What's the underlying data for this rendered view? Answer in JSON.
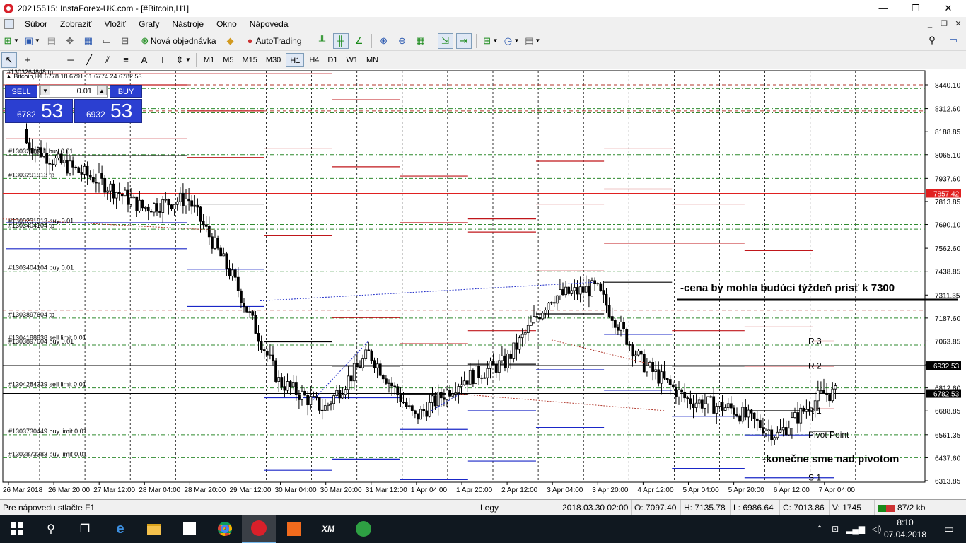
{
  "window": {
    "title": "20215515: InstaForex-UK.com - [#Bitcoin,H1]",
    "controls": {
      "minimize": "—",
      "maximize": "❐",
      "close": "✕"
    }
  },
  "menu": {
    "items": [
      "Súbor",
      "Zobraziť",
      "Vložiť",
      "Grafy",
      "Nástroje",
      "Okno",
      "Nápoveda"
    ],
    "mdi_controls": {
      "minimize": "_",
      "restore": "❐",
      "close": "✕"
    }
  },
  "toolbar": {
    "new_order_label": "Nová objednávka",
    "autotrading_label": "AutoTrading"
  },
  "timeframes": {
    "items": [
      "M1",
      "M5",
      "M15",
      "M30",
      "H1",
      "H4",
      "D1",
      "W1",
      "MN"
    ],
    "active": "H1"
  },
  "chart": {
    "symbol_line": "▲ Bitcoin,H1  6778.18 6791.61 6774.24 6782.53",
    "header_partial": "#1303264848 tp",
    "one_click": {
      "sell_label": "SELL",
      "buy_label": "BUY",
      "lot": "0.01",
      "sell_price_small": "6782",
      "sell_price_big": "53",
      "buy_price_small": "6932",
      "buy_price_big": "53"
    },
    "price_axis": [
      "8440.10",
      "8312.60",
      "8188.85",
      "8065.10",
      "7937.60",
      "7813.85",
      "7690.10",
      "7562.60",
      "7438.85",
      "7311.35",
      "7187.60",
      "7063.85",
      "6936.35",
      "6812.60",
      "6688.85",
      "6561.35",
      "6437.60",
      "6313.85"
    ],
    "price_markers": [
      {
        "label": "7857.42",
        "color": "#e02020",
        "value": 7857.42
      },
      {
        "label": "6932.53",
        "color": "#000000",
        "value": 6932.53
      },
      {
        "label": "6782.53",
        "color": "#000000",
        "value": 6782.53
      }
    ],
    "time_axis": [
      "26 Mar 2018",
      "26 Mar 20:00",
      "27 Mar 12:00",
      "28 Mar 04:00",
      "28 Mar 20:00",
      "29 Mar 12:00",
      "30 Mar 04:00",
      "30 Mar 20:00",
      "31 Mar 12:00",
      "1 Apr 04:00",
      "1 Apr 20:00",
      "2 Apr 12:00",
      "3 Apr 04:00",
      "3 Apr 20:00",
      "4 Apr 12:00",
      "5 Apr 04:00",
      "5 Apr 20:00",
      "6 Apr 12:00",
      "7 Apr 04:00"
    ],
    "order_labels": [
      {
        "text": "#1303291911 buy 0.01",
        "value": 8065.1
      },
      {
        "text": "#1303291913 tp",
        "value": 7937.6
      },
      {
        "text": "#1303291913 buy 0.01",
        "value": 7690.1
      },
      {
        "text": "#1303404104 tp",
        "value": 7665.0
      },
      {
        "text": "#1303404104 buy 0.01",
        "value": 7438.85
      },
      {
        "text": "#1303897604 tp",
        "value": 7187.6
      },
      {
        "text": "#1304188838 sell limit 0.01",
        "value": 7063.85
      },
      {
        "text": "#1303897604 buy 0.01",
        "value": 7043.0
      },
      {
        "text": "#1304284339 sell limit 0.01",
        "value": 6812.6
      },
      {
        "text": "#1303730449 buy limit 0.01",
        "value": 6561.35
      },
      {
        "text": "#1303873383 buy limit 0.01",
        "value": 6437.6
      }
    ],
    "pivot_labels": [
      {
        "text": "R 3",
        "value": 7063.85
      },
      {
        "text": "R 2",
        "value": 6930.0
      },
      {
        "text": "R 1",
        "value": 6688.85
      },
      {
        "text": "Pivot Point",
        "value": 6561.35
      },
      {
        "text": "S 1",
        "value": 6330.0
      }
    ],
    "annotations": [
      {
        "text": "-cena by mohla budúci týždeň prísť k 7300"
      },
      {
        "text": "-konečne sme nad pivotom"
      }
    ]
  },
  "statusbar": {
    "help": "Pre nápovedu stlačte F1",
    "profile": "Legy",
    "datetime": "2018.03.30 02:00",
    "open": "O: 7097.40",
    "high": "H: 7135.78",
    "low": "L: 6986.64",
    "close": "C: 7013.86",
    "volume": "V: 1745",
    "traffic": "87/2 kb"
  },
  "taskbar": {
    "time": "8:10",
    "date": "07.04.2018"
  },
  "colors": {
    "accent_blue": "#2b3fd1",
    "resistance_red": "#e02020",
    "support_blue": "#1a27c7",
    "grid_green": "#2f8a2f",
    "bg": "#ffffff"
  },
  "chart_data": {
    "type": "candlestick",
    "symbol": "Bitcoin",
    "timeframe": "H1",
    "x_range": [
      "2018-03-26",
      "2018-04-07"
    ],
    "ylim": [
      6313.85,
      8440.1
    ],
    "approx_close_path": [
      {
        "t": "26 Mar 2018",
        "v": 8200
      },
      {
        "t": "26 Mar 20:00",
        "v": 8040
      },
      {
        "t": "27 Mar 12:00",
        "v": 7930
      },
      {
        "t": "28 Mar 04:00",
        "v": 7780
      },
      {
        "t": "28 Mar 20:00",
        "v": 7830
      },
      {
        "t": "29 Mar 12:00",
        "v": 7400
      },
      {
        "t": "30 Mar 04:00",
        "v": 6850
      },
      {
        "t": "30 Mar 20:00",
        "v": 6700
      },
      {
        "t": "31 Mar 12:00",
        "v": 7000
      },
      {
        "t": "1 Apr 04:00",
        "v": 6650
      },
      {
        "t": "1 Apr 20:00",
        "v": 6850
      },
      {
        "t": "2 Apr 12:00",
        "v": 6950
      },
      {
        "t": "3 Apr 04:00",
        "v": 7300
      },
      {
        "t": "3 Apr 20:00",
        "v": 7350
      },
      {
        "t": "4 Apr 12:00",
        "v": 6950
      },
      {
        "t": "5 Apr 04:00",
        "v": 6750
      },
      {
        "t": "5 Apr 20:00",
        "v": 6700
      },
      {
        "t": "6 Apr 12:00",
        "v": 6560
      },
      {
        "t": "7 Apr 04:00",
        "v": 6782.53
      }
    ]
  }
}
